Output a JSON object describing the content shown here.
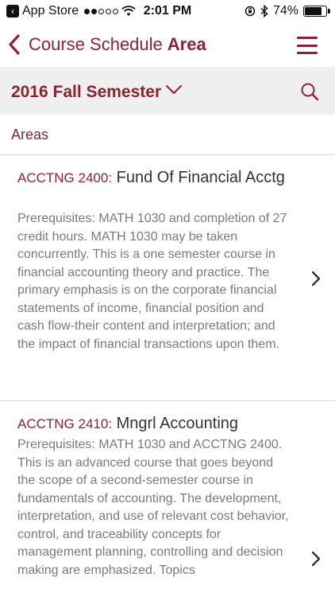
{
  "status_bar": {
    "back_app": "App Store",
    "time": "2:01 PM",
    "battery": "74%",
    "battery_level": 0.74
  },
  "nav": {
    "title_main": "Course Schedule",
    "title_bold": "Area",
    "accent_color": "#8a2432"
  },
  "semester": {
    "label": "2016 Fall Semester"
  },
  "section": {
    "label": "Areas"
  },
  "courses": [
    {
      "code": "ACCTNG 2400:",
      "title": "Fund Of Financial Acctg",
      "description": "Prerequisites: MATH 1030 and completion of 27 credit hours. MATH 1030 may be taken concurrently. This is a one semester course in financial accounting theory and practice. The primary emphasis is on the corporate financial statements of income, financial position and cash flow-their content and interpretation; and the impact of financial transactions upon them."
    },
    {
      "code": "ACCTNG 2410:",
      "title": "Mngrl Accounting",
      "description": "Prerequisites: MATH 1030 and ACCTNG 2400. This is an advanced course that goes beyond the scope of a second-semester course in fundamentals of accounting. The development, interpretation, and use of relevant cost behavior, control, and traceability concepts for management planning, controlling and decision making are emphasized. Topics"
    }
  ]
}
